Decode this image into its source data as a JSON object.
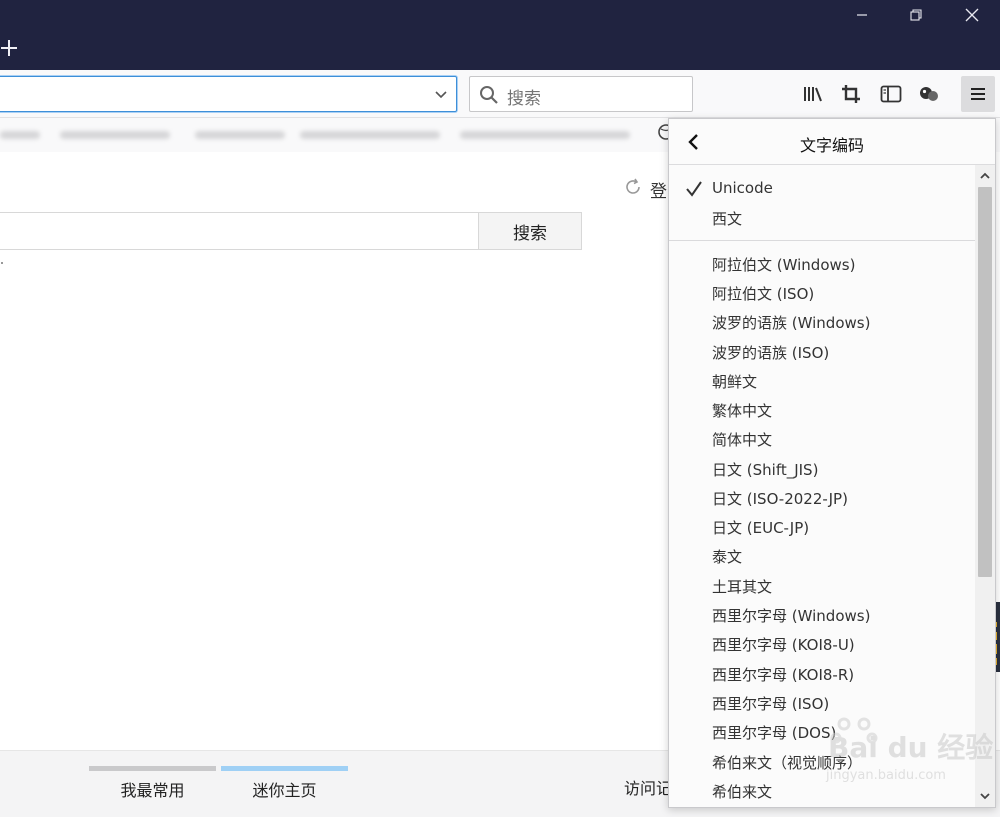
{
  "search": {
    "placeholder": "搜索"
  },
  "page": {
    "login_label": "登",
    "search_button": "搜索"
  },
  "bottom_tabs": [
    "我最常用",
    "迷你主页",
    "访问记"
  ],
  "encoding_menu": {
    "title": "文字编码",
    "group1": [
      {
        "label": "Unicode",
        "checked": true
      },
      {
        "label": "西文",
        "checked": false
      }
    ],
    "group2": [
      "阿拉伯文 (Windows)",
      "阿拉伯文 (ISO)",
      "波罗的语族 (Windows)",
      "波罗的语族 (ISO)",
      "朝鲜文",
      "繁体中文",
      "简体中文",
      "日文 (Shift_JIS)",
      "日文 (ISO-2022-JP)",
      "日文 (EUC-JP)",
      "泰文",
      "土耳其文",
      "西里尔字母 (Windows)",
      "西里尔字母 (KOI8-U)",
      "西里尔字母 (KOI8-R)",
      "西里尔字母 (ISO)",
      "西里尔字母 (DOS)",
      "希伯来文（视觉顺序）",
      "希伯来文"
    ]
  },
  "watermark": {
    "brand": "Bai du 经验",
    "url": "jingyan.baidu.com"
  },
  "colors": {
    "titlebar": "#202340",
    "accent": "#3d8fd8"
  }
}
